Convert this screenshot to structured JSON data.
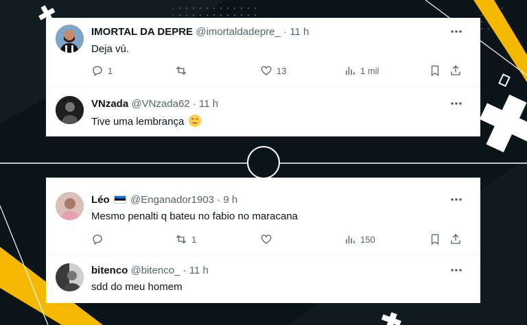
{
  "tweets": [
    {
      "name": "IMORTAL DA DEPRE",
      "handle": "@imortaldadepre_",
      "time": "11 h",
      "text": "Deja vù.",
      "replies": "1",
      "retweets": "",
      "likes": "13",
      "views": "1 mil",
      "avatar_icon": "avatar-bald-man"
    },
    {
      "name": "VNzada",
      "handle": "@VNzada62",
      "time": "11 h",
      "text": "Tive uma lembrança",
      "emoji": "relieved-face-emoji",
      "avatar_icon": "avatar-dark"
    },
    {
      "name": "Léo",
      "flag": "estonia-flag",
      "handle": "@Enganador1903",
      "time": "9 h",
      "text": "Mesmo penalti q bateu no fabio no maracana",
      "replies": "",
      "retweets": "1",
      "likes": "",
      "views": "150",
      "avatar_icon": "avatar-person"
    },
    {
      "name": "bitenco",
      "handle": "@bitenco_",
      "time": "11 h",
      "text": "sdd do meu homem",
      "avatar_icon": "avatar-bw"
    }
  ],
  "separator": "·",
  "colors": {
    "background": "#0b1419",
    "accent_yellow": "#f5b800",
    "text_primary": "#0f1419",
    "text_secondary": "#536471"
  }
}
